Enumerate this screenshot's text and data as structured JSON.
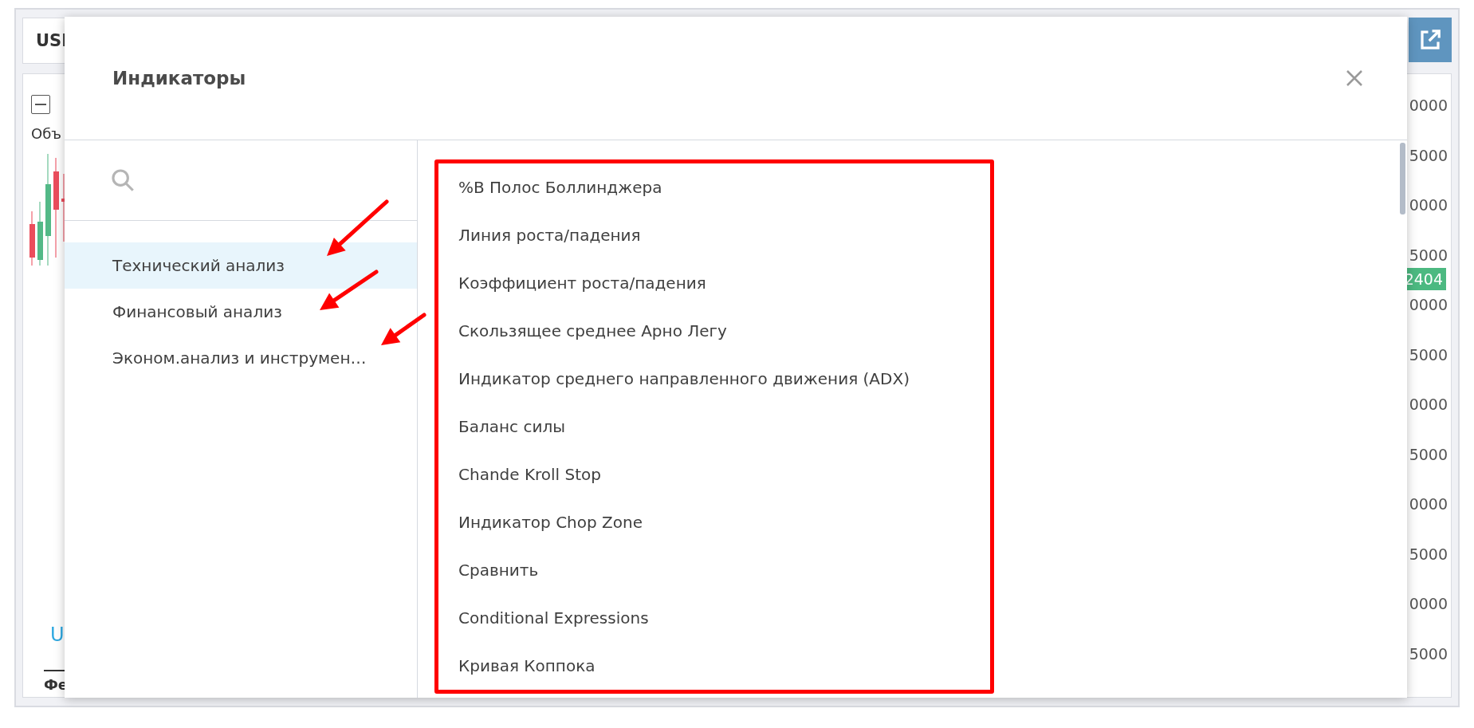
{
  "background": {
    "symbol": "USI",
    "legend": "Объ",
    "series_label": "U",
    "date_label": "Фе",
    "price_axis": [
      "0000",
      "5000",
      "0000",
      "5000",
      "0000",
      "5000",
      "0000",
      "5000",
      "0000",
      "5000",
      "0000",
      "5000"
    ],
    "price_tag": "2404"
  },
  "dialog": {
    "title": "Индикаторы",
    "categories": [
      {
        "label": "Технический анализ",
        "selected": true
      },
      {
        "label": "Финансовый анализ",
        "selected": false
      },
      {
        "label": "Эконом.анализ и инструмен…",
        "selected": false
      }
    ],
    "indicators": [
      "%B Полос Боллинджера",
      "Линия роста/падения",
      "Коэффициент роста/падения",
      "Скользящее среднее Арно Легу",
      "Индикатор среднего направленного движения (ADX)",
      "Баланс силы",
      "Chande Kroll Stop",
      "Индикатор Chop Zone",
      "Сравнить",
      "Conditional Expressions",
      "Кривая Коппока"
    ]
  }
}
